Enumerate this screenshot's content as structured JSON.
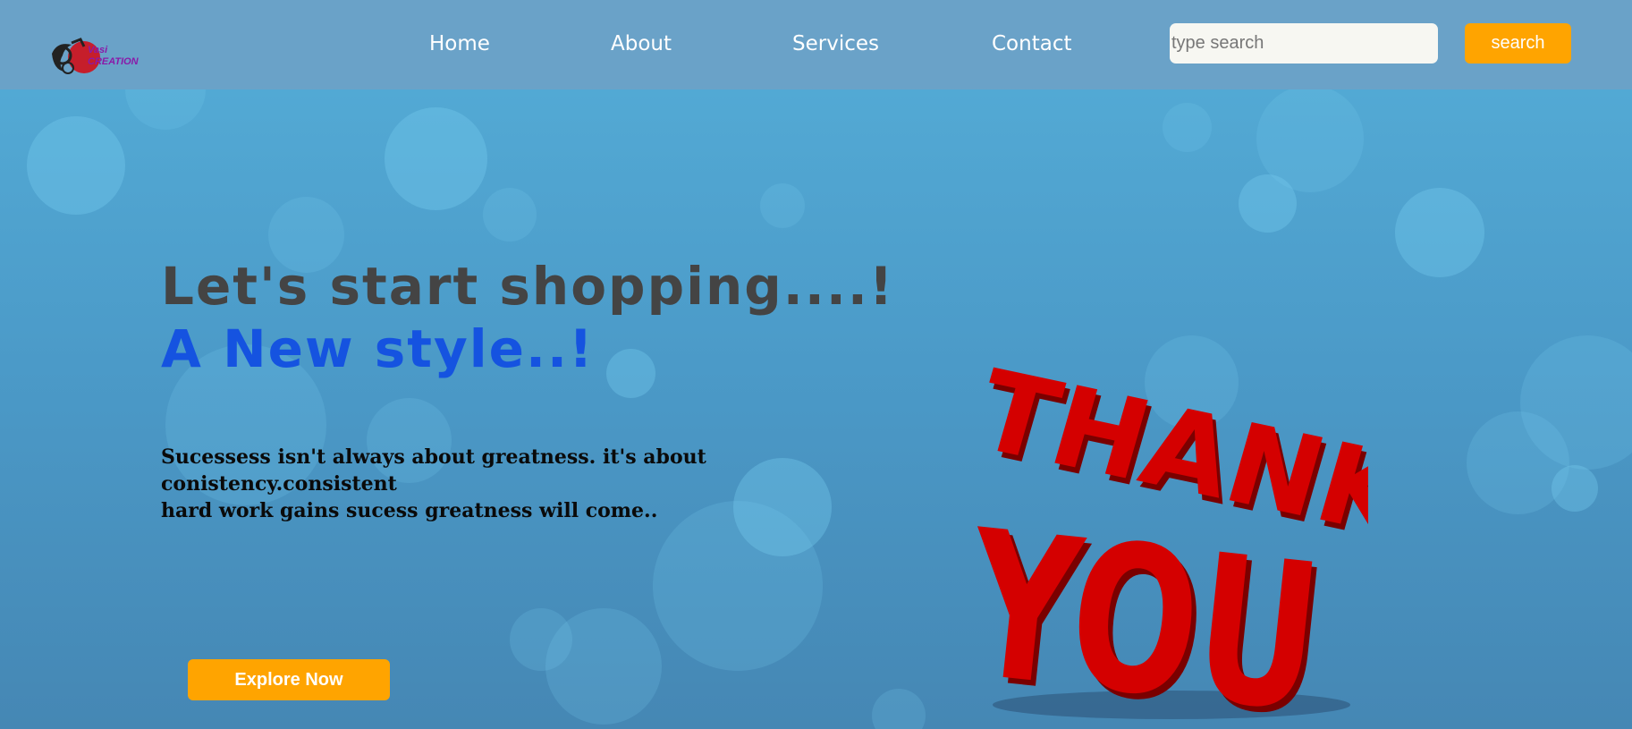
{
  "logo": {
    "text": "Vasi CREATION",
    "colors": {
      "accent": "#d0101a",
      "text": "#8a1aa8"
    }
  },
  "nav": {
    "items": [
      {
        "label": "Home"
      },
      {
        "label": "About"
      },
      {
        "label": "Services"
      },
      {
        "label": "Contact"
      }
    ]
  },
  "search": {
    "placeholder": "type search",
    "value": "",
    "button_label": "search"
  },
  "hero": {
    "headline": "Let's start shopping....!",
    "subheadline": "A New style..!",
    "tagline_lines": [
      "Sucessess isn't always about greatness. it's about",
      "conistency.consistent",
      "hard work gains sucess greatness will come.."
    ],
    "cta_label": "Explore Now",
    "image_text": {
      "line1": "THANK",
      "line2": "YOU"
    }
  },
  "colors": {
    "navbar": "#6aa2c8",
    "accent_button": "#ffa400",
    "headline": "#444444",
    "subheadline": "#1553e0",
    "thank_you": "#d40000"
  }
}
